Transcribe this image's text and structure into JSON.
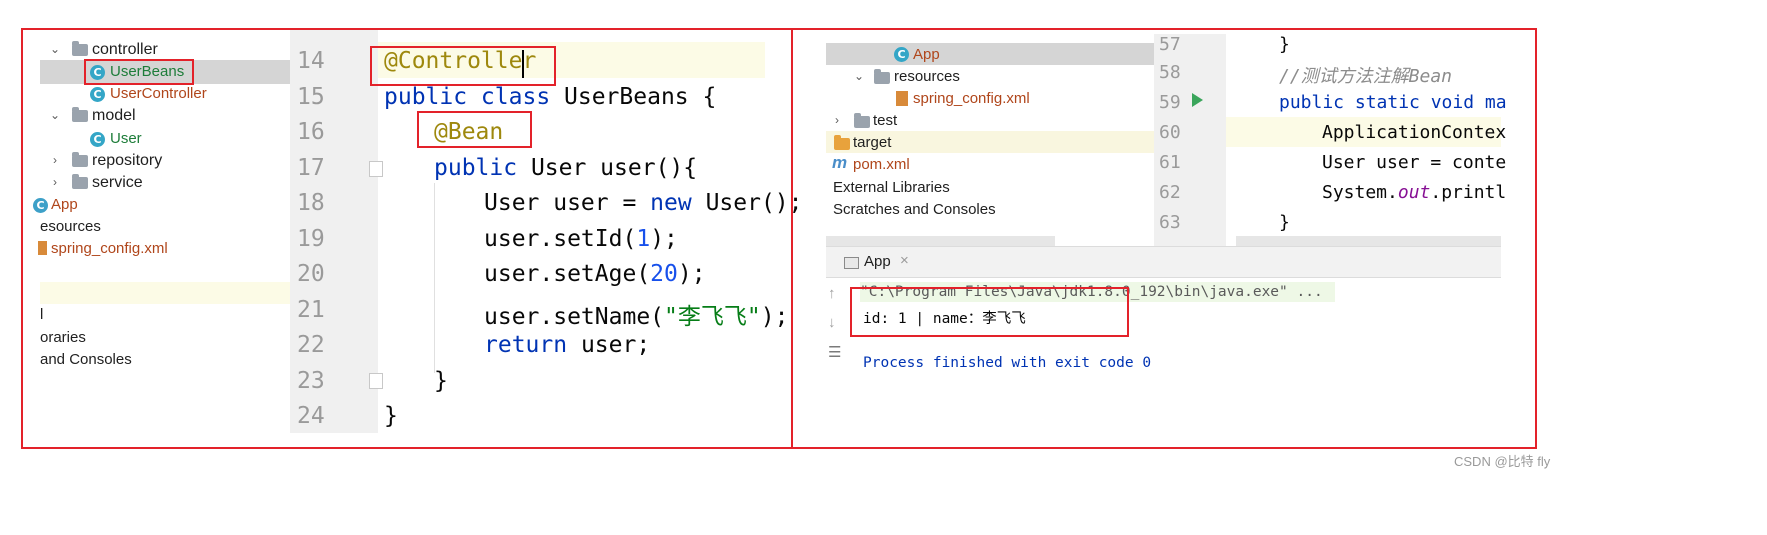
{
  "left": {
    "tree": {
      "controller": "controller",
      "userbeans": "UserBeans",
      "usercontroller": "UserController",
      "model": "model",
      "user": "User",
      "repository": "repository",
      "service": "service",
      "app": "App",
      "resources": "esources",
      "spring_config": "spring_config.xml",
      "cut_l": "l",
      "libraries": "oraries",
      "consoles": "and Consoles"
    },
    "line_numbers": [
      "14",
      "15",
      "16",
      "17",
      "18",
      "19",
      "20",
      "21",
      "22",
      "23",
      "24"
    ],
    "code": {
      "controller_ann": "@Controller",
      "l15_kw": "public class",
      "l15_rest": " UserBeans {",
      "bean_ann": "@Bean",
      "l17_kw": "public",
      "l17_rest": " User user(){",
      "l18_a": "User user = ",
      "l18_kw": "new",
      "l18_b": " User();",
      "l19_a": "user.setId(",
      "l19_num": "1",
      "l19_b": ");",
      "l20_a": "user.setAge(",
      "l20_num": "20",
      "l20_b": ");",
      "l21_a": "user.setName(",
      "l21_str": "\"李飞飞\"",
      "l21_b": ");",
      "l22_kw": "return",
      "l22_rest": " user;",
      "l23": "}",
      "l24": "}"
    }
  },
  "right": {
    "tree": {
      "app": "App",
      "resources": "resources",
      "spring_config": "spring_config.xml",
      "test": "test",
      "target": "target",
      "pom": "pom.xml",
      "ext_libs": "External Libraries",
      "scratches": "Scratches and Consoles"
    },
    "line_numbers": [
      "57",
      "58",
      "59",
      "60",
      "61",
      "62",
      "63"
    ],
    "code": {
      "l57": "}",
      "l58": "//测试方法注解Bean",
      "l59_kw": "public static void",
      "l59_rest": " ma",
      "l60": "ApplicationContex",
      "l61": "User user = conte",
      "l62_a": "System.",
      "l62_out": "out",
      "l62_b": ".printl",
      "l63": "}"
    },
    "run": {
      "tab": "App",
      "cmd": "\"C:\\Program Files\\Java\\jdk1.8.0_192\\bin\\java.exe\" ...",
      "output": "id: 1 | name：李飞飞",
      "exit": "Process finished with exit code 0"
    }
  },
  "watermark": "CSDN @比特 fly",
  "colors": {
    "red_box": "#e3222a",
    "keyword": "#0033b3",
    "annotation": "#9e880d",
    "number": "#1750eb",
    "string": "#067d17"
  }
}
